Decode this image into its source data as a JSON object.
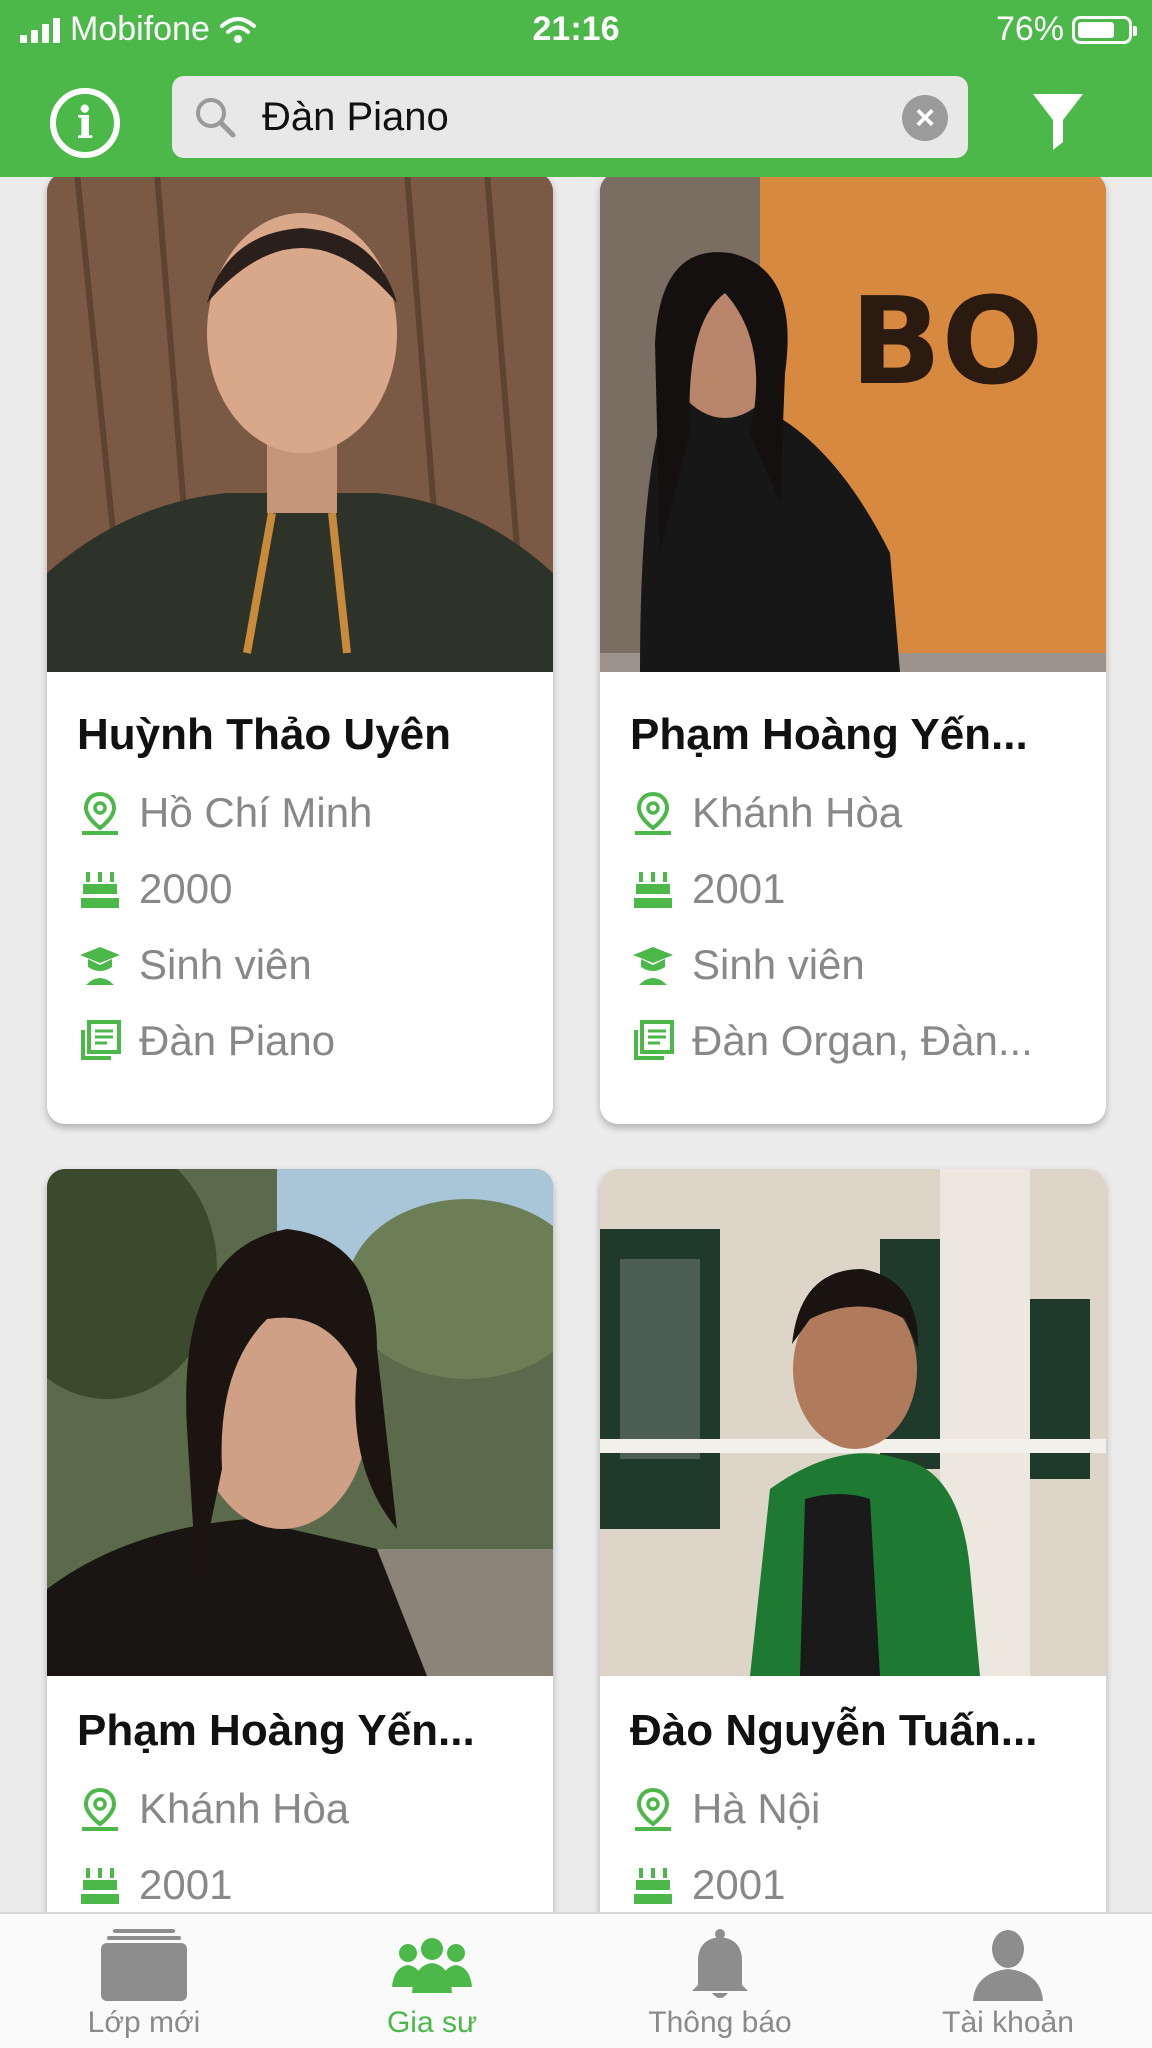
{
  "status_bar": {
    "carrier": "Mobifone",
    "time": "21:16",
    "battery": "76%",
    "battery_level": 0.76
  },
  "search": {
    "value": "Đàn Piano"
  },
  "colors": {
    "brand": "#4cb84a",
    "muted": "#888888"
  },
  "tutors": [
    {
      "name": "Huỳnh Thảo Uyên",
      "location": "Hồ Chí Minh",
      "birth_year": "2000",
      "occupation": "Sinh viên",
      "subjects": "Đàn Piano"
    },
    {
      "name": "Phạm Hoàng Yến...",
      "location": "Khánh Hòa",
      "birth_year": "2001",
      "occupation": "Sinh viên",
      "subjects": "Đàn Organ, Đàn..."
    },
    {
      "name": "Phạm Hoàng Yến...",
      "location": "Khánh Hòa",
      "birth_year": "2001"
    },
    {
      "name": "Đào Nguyễn Tuấn...",
      "location": "Hà Nội",
      "birth_year": "2001"
    }
  ],
  "tabs": [
    {
      "label": "Lớp mới",
      "icon": "folder-icon"
    },
    {
      "label": "Gia sư",
      "icon": "group-icon"
    },
    {
      "label": "Thông báo",
      "icon": "bell-icon"
    },
    {
      "label": "Tài khoản",
      "icon": "person-icon"
    }
  ]
}
